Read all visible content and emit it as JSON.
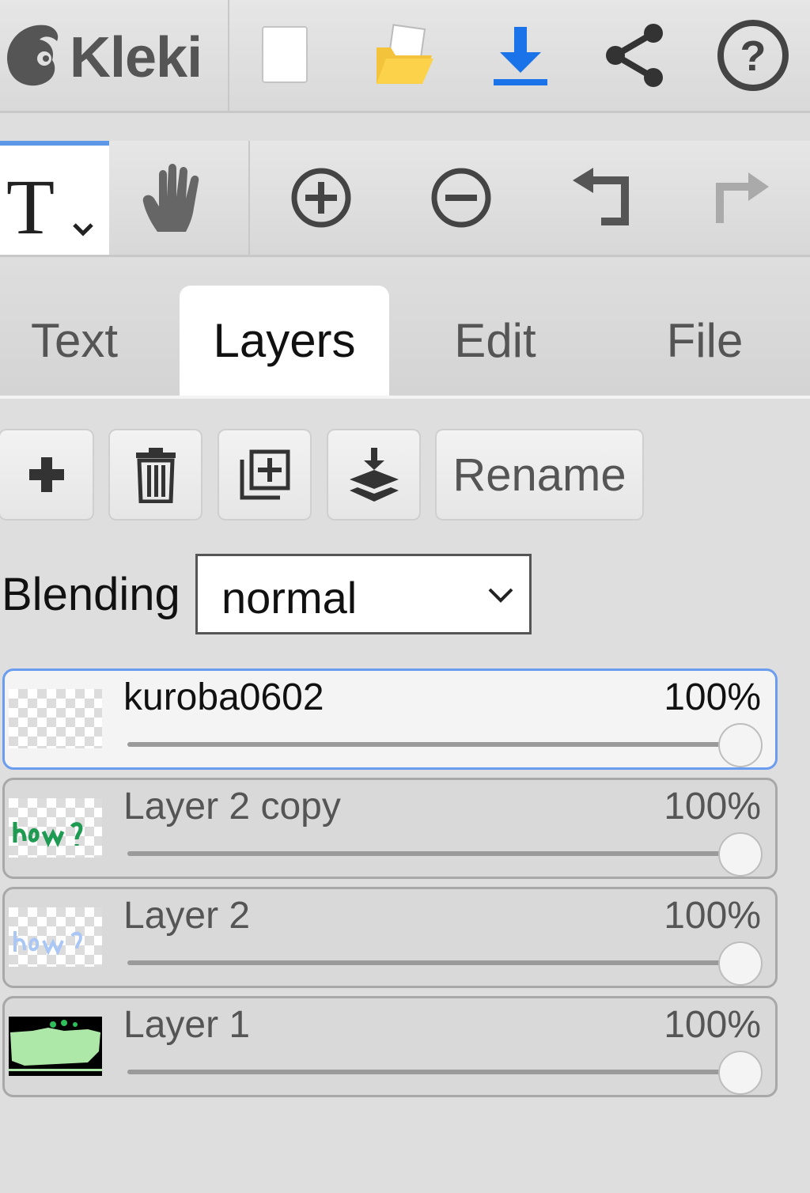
{
  "app": {
    "name": "Kleki",
    "accent_color": "#5d97e8",
    "download_color": "#1a73e8"
  },
  "topbar": {
    "icons": [
      "new-document-icon",
      "open-folder-icon",
      "download-icon",
      "share-icon",
      "help-icon"
    ]
  },
  "toolbar": {
    "active_tool": "T",
    "icons": [
      "text-tool-icon",
      "hand-tool-icon",
      "zoom-in-icon",
      "zoom-out-icon",
      "undo-icon",
      "redo-icon"
    ]
  },
  "tabs": [
    {
      "label": "Text",
      "active": false
    },
    {
      "label": "Layers",
      "active": true
    },
    {
      "label": "Edit",
      "active": false
    },
    {
      "label": "File",
      "active": false
    }
  ],
  "layer_actions": {
    "icons": [
      "add-layer-icon",
      "delete-layer-icon",
      "duplicate-layer-icon",
      "merge-down-icon"
    ],
    "rename_label": "Rename"
  },
  "blending": {
    "label": "Blending",
    "value": "normal"
  },
  "layers": [
    {
      "name": "kuroba0602",
      "opacity": "100%",
      "opacity_value": 1.0,
      "active": true
    },
    {
      "name": "Layer 2 copy",
      "opacity": "100%",
      "opacity_value": 1.0,
      "active": false
    },
    {
      "name": "Layer 2",
      "opacity": "100%",
      "opacity_value": 1.0,
      "active": false
    },
    {
      "name": "Layer 1",
      "opacity": "100%",
      "opacity_value": 1.0,
      "active": false
    }
  ]
}
